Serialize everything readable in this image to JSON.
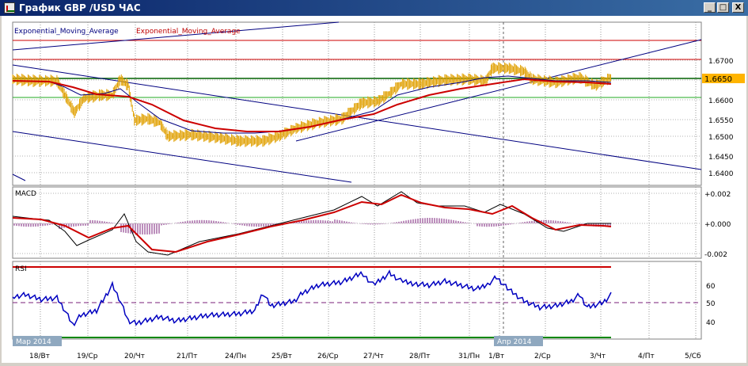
{
  "window": {
    "title": "График GBP /USD ЧАС",
    "min_glyph": "_",
    "max_glyph": "□",
    "close_glyph": "X"
  },
  "price_pane": {
    "legend": [
      "Exponential_Moving_Average",
      "Exponential_Moving_Average"
    ],
    "legend_colors": [
      "#00007f",
      "#bf0000"
    ],
    "y_ticks": [
      "1.6700",
      "1.6650",
      "1.6600",
      "1.6550",
      "1.6500",
      "1.6450",
      "1.6400"
    ],
    "current_price": "1.6650"
  },
  "macd_pane": {
    "label": "MACD",
    "y_ticks": [
      "+0.002",
      "+0.000",
      "-0.002"
    ]
  },
  "rsi_pane": {
    "label": "RSI",
    "y_ticks": [
      "60",
      "50",
      "40"
    ]
  },
  "x_axis": {
    "labels": [
      "18/Вт",
      "19/Ср",
      "20/Чт",
      "21/Пт",
      "24/Пн",
      "25/Вт",
      "26/Ср",
      "27/Чт",
      "28/Пт",
      "31/Пн",
      "1/Вт",
      "2/Ср",
      "3/Чт",
      "4/Пт",
      "5/Сб"
    ],
    "month_tags": [
      "Мар 2014",
      "Апр 2014"
    ]
  },
  "colors": {
    "price_bars": "#e0a000",
    "ema_fast": "#000080",
    "ema_slow": "#cc0000",
    "rsi": "#0000c0",
    "resistance": "#cc0000",
    "support": "#008800",
    "trend": "#000080",
    "highlight": "#ffb400"
  }
}
